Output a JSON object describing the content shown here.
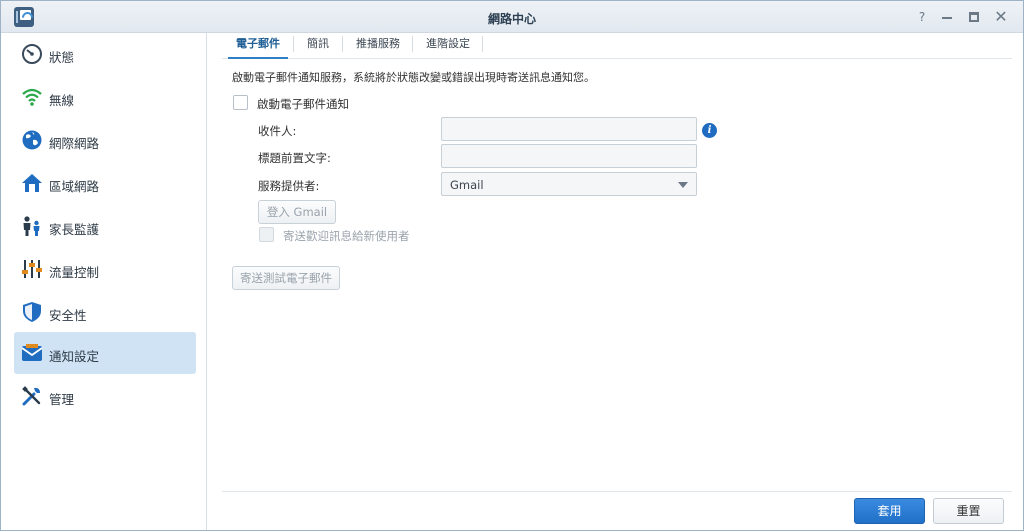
{
  "window": {
    "title": "網路中心",
    "help_glyph": "?",
    "close_glyph": "✕"
  },
  "sidebar": {
    "items": [
      {
        "label": "狀態",
        "icon": "gauge-icon",
        "active": false
      },
      {
        "label": "無線",
        "icon": "wifi-icon",
        "active": false
      },
      {
        "label": "網際網路",
        "icon": "globe-icon",
        "active": false
      },
      {
        "label": "區域網路",
        "icon": "home-network-icon",
        "active": false
      },
      {
        "label": "家長監護",
        "icon": "parent-child-icon",
        "active": false
      },
      {
        "label": "流量控制",
        "icon": "sliders-icon",
        "active": false
      },
      {
        "label": "安全性",
        "icon": "shield-icon",
        "active": false
      },
      {
        "label": "通知設定",
        "icon": "notification-mail-icon",
        "active": true
      },
      {
        "label": "管理",
        "icon": "tools-icon",
        "active": false
      }
    ]
  },
  "tabs": [
    {
      "label": "電子郵件",
      "active": true
    },
    {
      "label": "簡訊",
      "active": false
    },
    {
      "label": "推播服務",
      "active": false
    },
    {
      "label": "進階設定",
      "active": false
    }
  ],
  "email": {
    "description": "啟動電子郵件通知服務，系統將於狀態改變或錯誤出現時寄送訊息通知您。",
    "enable_label": "啟動電子郵件通知",
    "recipient_label": "收件人:",
    "recipient_value": "",
    "subject_prefix_label": "標題前置文字:",
    "subject_prefix_value": "",
    "provider_label": "服務提供者:",
    "provider_value": "Gmail",
    "login_button": "登入 Gmail",
    "welcome_label": "寄送歡迎訊息給新使用者",
    "test_button": "寄送測試電子郵件",
    "info_glyph": "i"
  },
  "footer": {
    "apply_label": "套用",
    "reset_label": "重置"
  },
  "colors": {
    "accent": "#2f7ec4",
    "active_sidebar": "#cfe3f5",
    "apply_button": "#2170c9"
  }
}
